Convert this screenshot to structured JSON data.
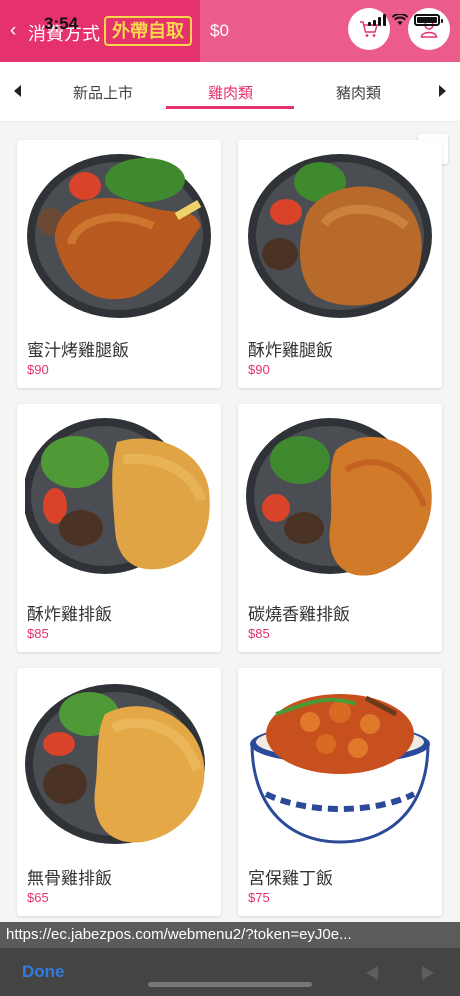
{
  "status_bar": {
    "time": "3:54"
  },
  "header": {
    "back_label": "消費方式",
    "mode_badge": "外帶自取",
    "cart_total": "$0",
    "colors": {
      "primary": "#e5326d",
      "badge": "#f6d84a"
    },
    "icons": [
      "cart-icon",
      "user-icon"
    ]
  },
  "tabs": [
    {
      "label": "新品上市",
      "active": false
    },
    {
      "label": "雞肉類",
      "active": true
    },
    {
      "label": "豬肉類",
      "active": false
    }
  ],
  "products": [
    {
      "name": "蜜汁烤雞腿飯",
      "price": "$90"
    },
    {
      "name": "酥炸雞腿飯",
      "price": "$90"
    },
    {
      "name": "酥炸雞排飯",
      "price": "$85"
    },
    {
      "name": "碳燒香雞排飯",
      "price": "$85"
    },
    {
      "name": "無骨雞排飯",
      "price": "$65"
    },
    {
      "name": "宮保雞丁飯",
      "price": "$75"
    }
  ],
  "browser": {
    "url": "https://ec.jabezpos.com/webmenu2/?token=eyJ0e...",
    "done_label": "Done"
  }
}
